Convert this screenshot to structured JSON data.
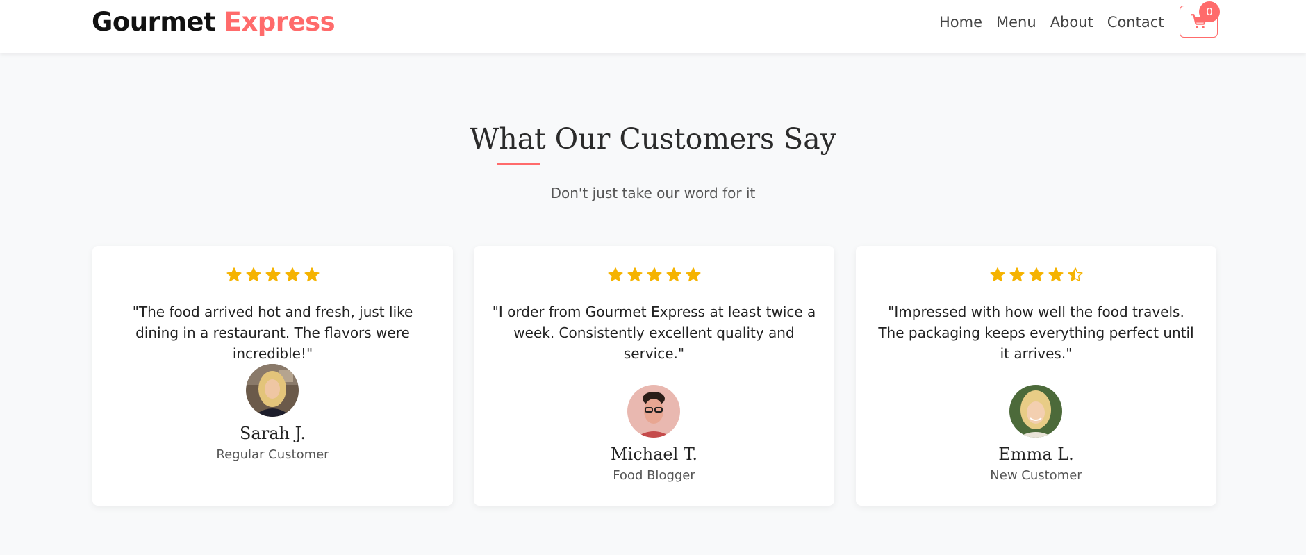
{
  "header": {
    "brand_part1": "Gourmet",
    "brand_part2": "Express",
    "nav": [
      "Home",
      "Menu",
      "About",
      "Contact"
    ],
    "cart_count": "0",
    "accent_color": "#ff6b6b"
  },
  "section": {
    "title": "What Our Customers Say",
    "subtitle": "Don't just take our word for it"
  },
  "testimonials": [
    {
      "rating": 5,
      "quote": "\"The food arrived hot and fresh, just like dining in a restaurant. The flavors were incredible!\"",
      "name": "Sarah J.",
      "role": "Regular Customer"
    },
    {
      "rating": 5,
      "quote": "\"I order from Gourmet Express at least twice a week. Consistently excellent quality and service.\"",
      "name": "Michael T.",
      "role": "Food Blogger"
    },
    {
      "rating": 4.5,
      "quote": "\"Impressed with how well the food travels. The packaging keeps everything perfect until it arrives.\"",
      "name": "Emma L.",
      "role": "New Customer"
    }
  ],
  "star_color": "#f5b301"
}
